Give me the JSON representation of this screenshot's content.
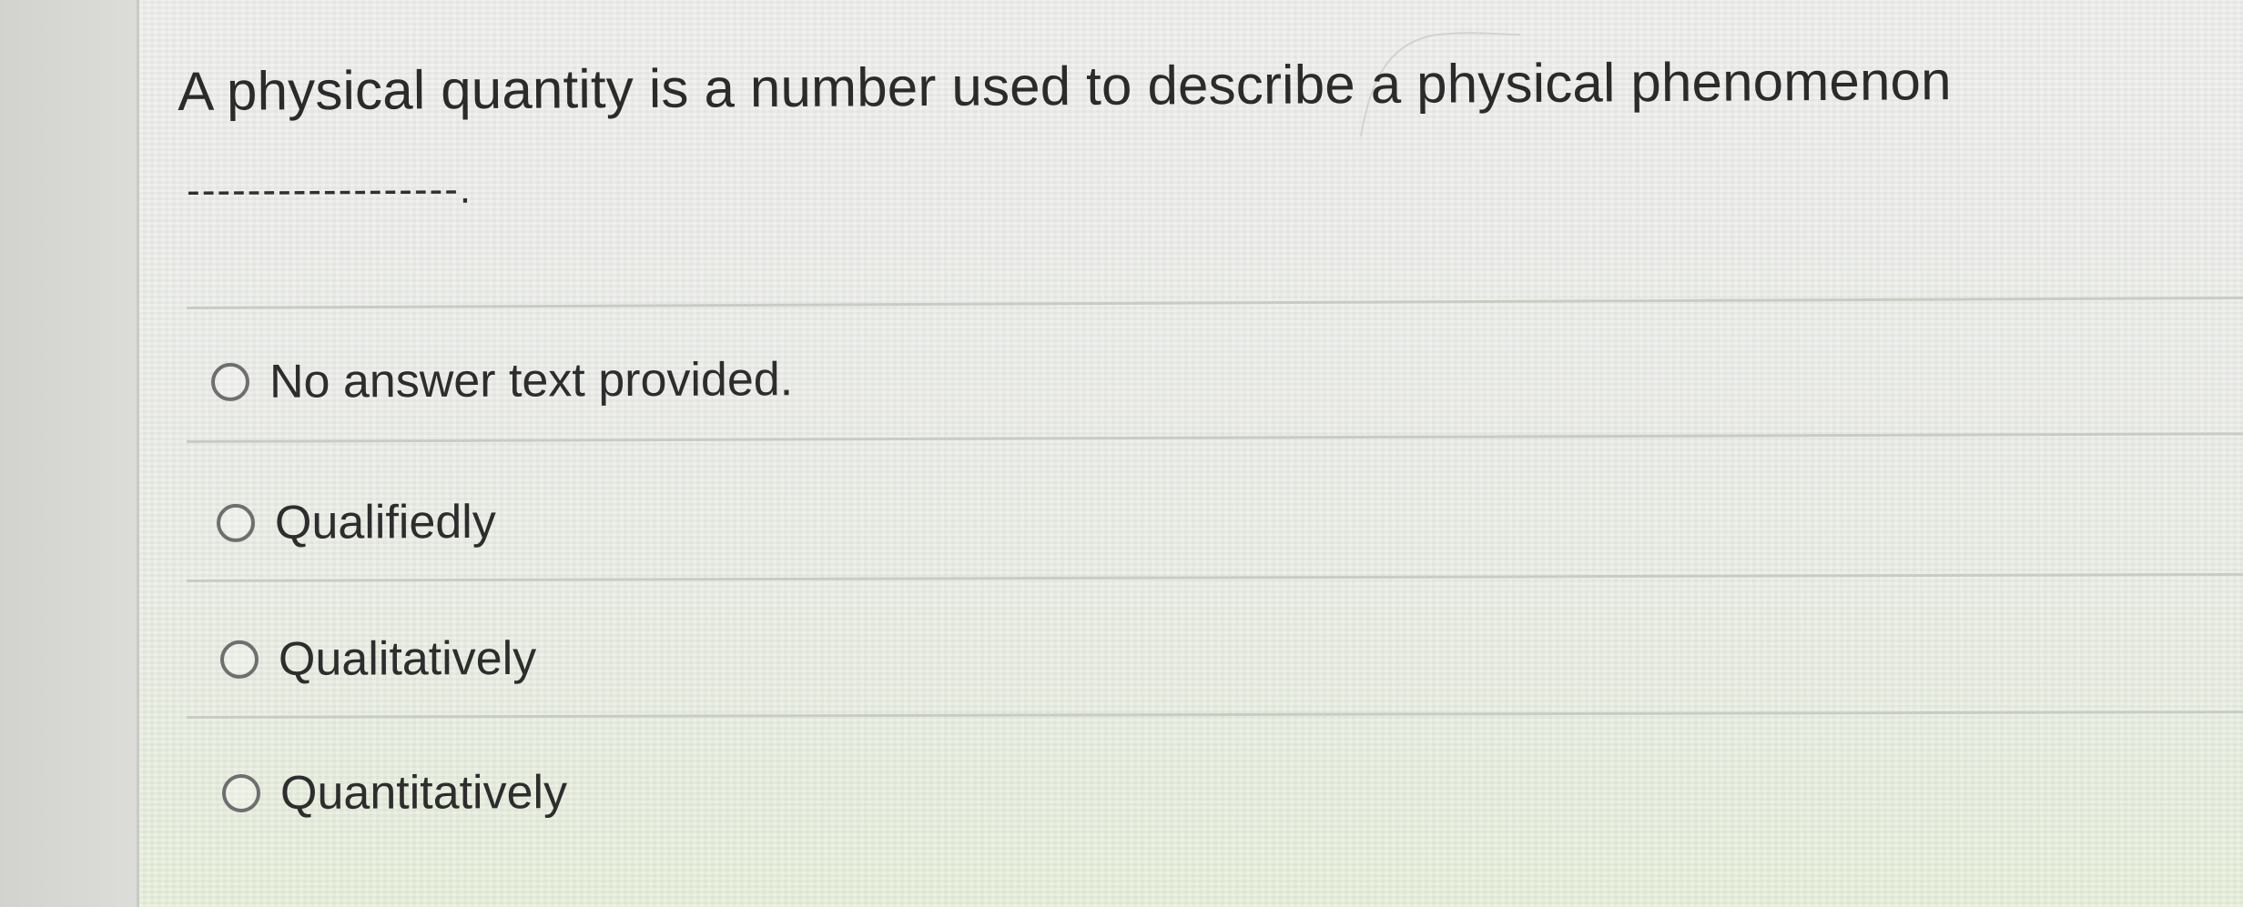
{
  "question": {
    "text": "A physical quantity is a number used to describe a physical phenomenon",
    "blank": "------------------."
  },
  "options": [
    {
      "label": "No answer text provided.",
      "selected": false
    },
    {
      "label": "Qualifiedly",
      "selected": false
    },
    {
      "label": "Qualitatively",
      "selected": false
    },
    {
      "label": "Quantitatively",
      "selected": false
    }
  ],
  "icons": {
    "radio": "radio-unchecked-icon"
  },
  "colors": {
    "text": "#2d2d2d",
    "radio_border": "#6f6f6f",
    "divider": "#c8ccc4"
  }
}
